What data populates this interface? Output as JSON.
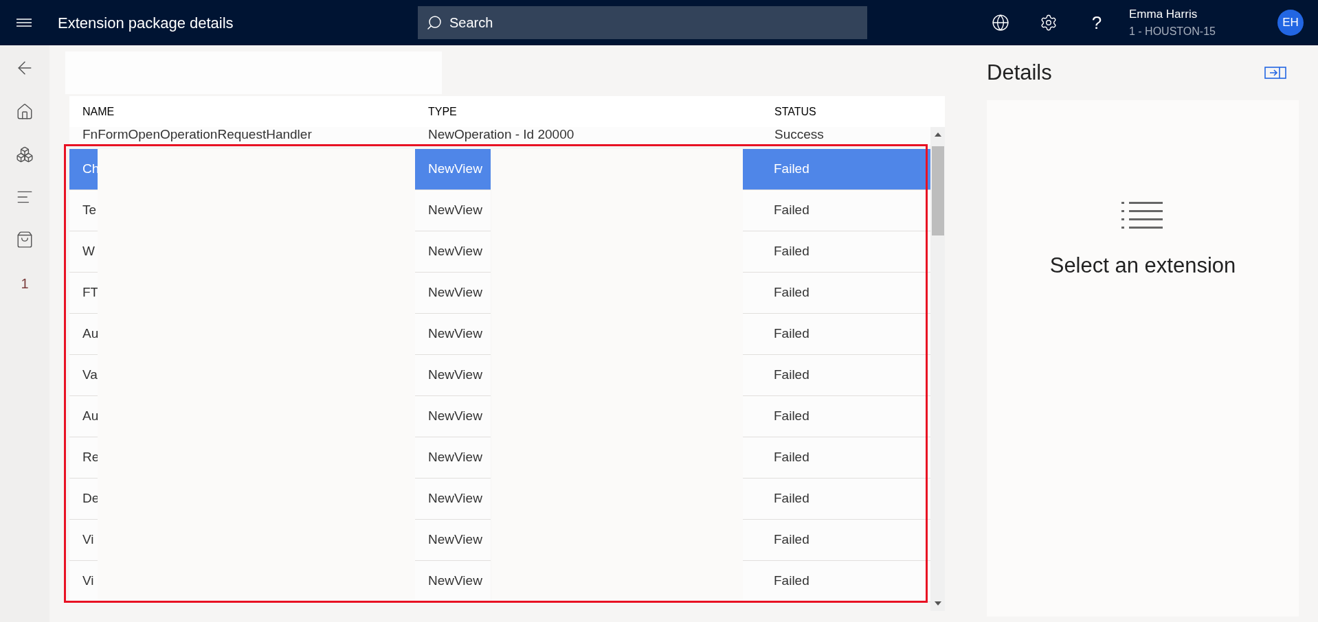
{
  "top_bar": {
    "title": "Extension package details",
    "search": {
      "placeholder": "Search"
    },
    "help": "?",
    "user": {
      "name": "Emma Harris",
      "store": "1 - HOUSTON-15",
      "initials": "EH"
    }
  },
  "sidebar": {
    "badge": "1"
  },
  "table": {
    "columns": [
      "NAME",
      "TYPE",
      "STATUS"
    ],
    "partial_row": {
      "name": "FnFormOpenOperationRequestHandler",
      "type": "NewOperation - Id 20000",
      "status": "Success"
    },
    "rows": [
      {
        "name": "Ch",
        "type": "NewView",
        "status": "Failed",
        "selected": true
      },
      {
        "name": "Te",
        "type": "NewView",
        "status": "Failed",
        "selected": false
      },
      {
        "name": "W",
        "type": "NewView",
        "status": "Failed",
        "selected": false
      },
      {
        "name": "FT",
        "type": "NewView",
        "status": "Failed",
        "selected": false
      },
      {
        "name": "Au",
        "type": "NewView",
        "status": "Failed",
        "selected": false
      },
      {
        "name": "Va",
        "type": "NewView",
        "status": "Failed",
        "selected": false
      },
      {
        "name": "Au",
        "type": "NewView",
        "status": "Failed",
        "selected": false
      },
      {
        "name": "Re",
        "type": "NewView",
        "status": "Failed",
        "selected": false
      },
      {
        "name": "De",
        "type": "NewView",
        "status": "Failed",
        "selected": false
      },
      {
        "name": "Vi",
        "type": "NewView",
        "status": "Failed",
        "selected": false
      },
      {
        "name": "Vi",
        "type": "NewView",
        "status": "Failed",
        "selected": false
      }
    ]
  },
  "details": {
    "title": "Details",
    "empty_message": "Select an extension"
  }
}
